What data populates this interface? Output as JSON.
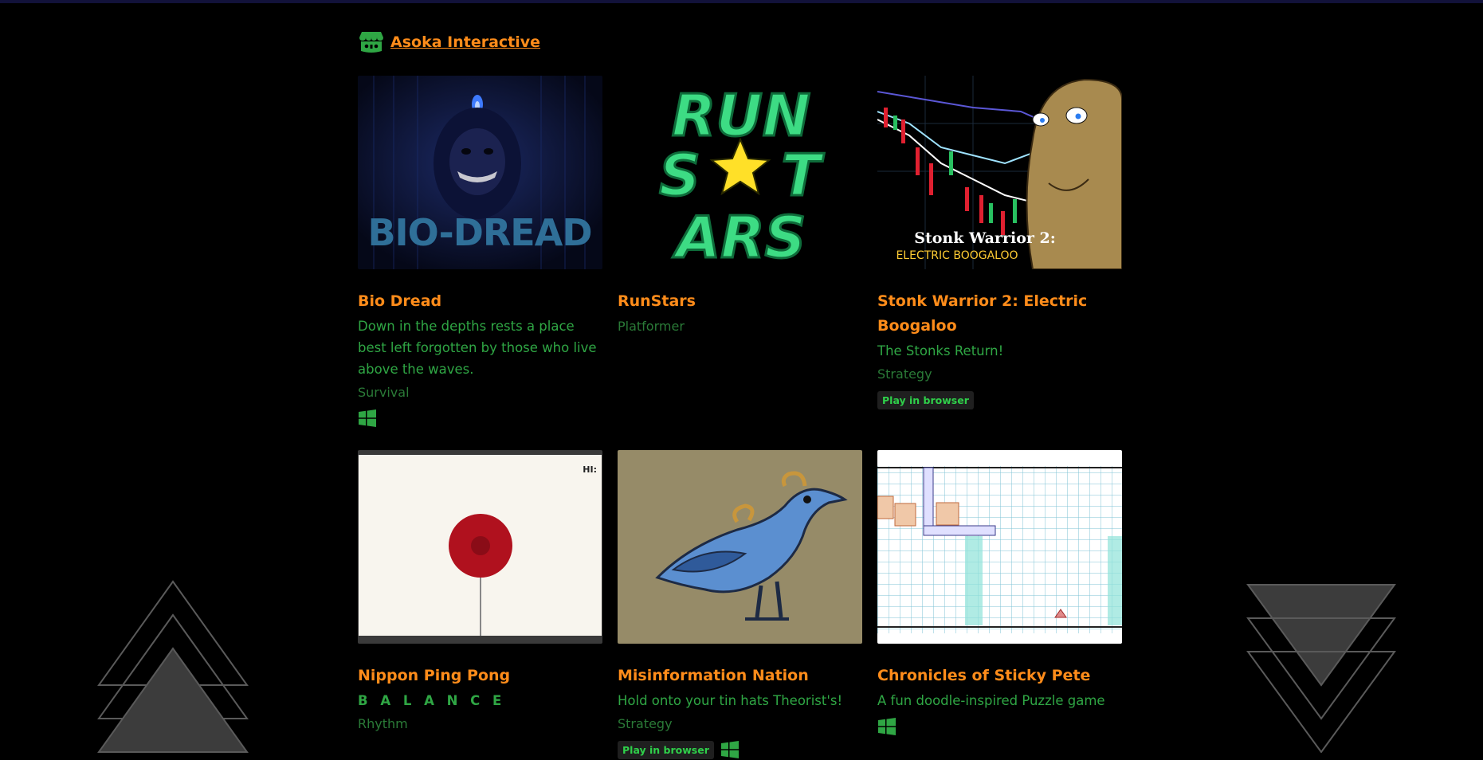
{
  "publisher": {
    "name": "Asoka Interactive"
  },
  "games": [
    {
      "title": "Bio Dread",
      "description": "Down in the depths rests a place best left forgotten by those who live above the waves.",
      "genre": "Survival",
      "windows": true,
      "browser": false,
      "thumb_text": "BIO-DREAD"
    },
    {
      "title": "RunStars",
      "description": "",
      "genre": "Platformer",
      "windows": false,
      "browser": false,
      "thumb_text_1": "RUN",
      "thumb_text_2a": "S",
      "thumb_text_2b": "T",
      "thumb_text_3": "ARS"
    },
    {
      "title": "Stonk Warrior 2: Electric Boogaloo",
      "description": "The Stonks Return!",
      "genre": "Strategy",
      "windows": false,
      "browser": true,
      "browser_label": "Play in browser",
      "thumb_text_1": "Stonk Warrior 2:",
      "thumb_text_2": "ELECTRIC BOOGALOO"
    },
    {
      "title": "Nippon Ping Pong",
      "description": "B A L A N C E",
      "genre": "Rhythm",
      "windows": false,
      "browser": false,
      "thumb_text": "HI:"
    },
    {
      "title": "Misinformation Nation",
      "description": "Hold onto your tin hats Theorist's!",
      "genre": "Strategy",
      "windows": true,
      "browser": true,
      "browser_label": "Play in browser"
    },
    {
      "title": "Chronicles of Sticky Pete",
      "description": "A fun doodle-inspired Puzzle game",
      "genre": "",
      "windows": true,
      "browser": false
    }
  ],
  "colors": {
    "title": "#ff8c1a",
    "description": "#2fa644",
    "genre": "#2a7a37",
    "background": "#000000"
  }
}
